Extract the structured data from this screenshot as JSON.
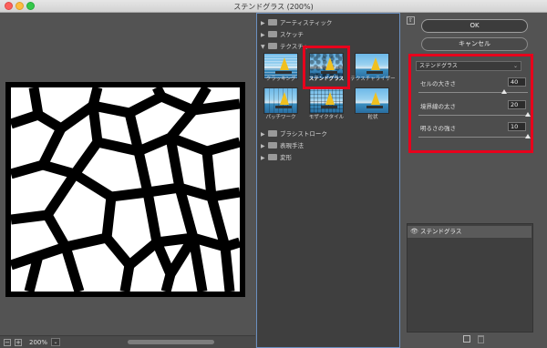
{
  "window": {
    "title": "ステンドグラス (200%)"
  },
  "preview": {
    "zoom_level": "200%",
    "zoom_out_label": "−",
    "zoom_in_label": "+",
    "dropdown_glyph": "⌄"
  },
  "gallery": {
    "categories": [
      {
        "label": "アーティスティック",
        "expanded": false
      },
      {
        "label": "スケッチ",
        "expanded": false
      },
      {
        "label": "テクスチャ",
        "expanded": true
      }
    ],
    "texture_items": [
      {
        "label": "クラッキング",
        "selected": false
      },
      {
        "label": "ステンドグラス",
        "selected": true
      },
      {
        "label": "テクスチャライザー",
        "selected": false
      },
      {
        "label": "パッチワーク",
        "selected": false
      },
      {
        "label": "モザイクタイル",
        "selected": false
      },
      {
        "label": "粒状",
        "selected": false
      }
    ],
    "more_categories": [
      {
        "label": "ブラシストローク"
      },
      {
        "label": "表現手法"
      },
      {
        "label": "変形"
      }
    ],
    "arrow_collapsed": "▶",
    "arrow_expanded": "▼"
  },
  "actions": {
    "ok_label": "OK",
    "cancel_label": "キャンセル",
    "collapse_glyph": "⇧"
  },
  "filter_settings": {
    "selected_filter": "ステンドグラス",
    "chevron": "⌄",
    "params": [
      {
        "label": "セルの大きさ",
        "value": "40",
        "fraction": 0.78
      },
      {
        "label": "境界線の太さ",
        "value": "20",
        "fraction": 1.0
      },
      {
        "label": "明るさの強さ",
        "value": "10",
        "fraction": 1.0
      }
    ]
  },
  "layers": {
    "items": [
      {
        "label": "ステンドグラス",
        "eye_glyph": "👁"
      }
    ]
  },
  "colors": {
    "highlight": "#e8001c",
    "panel": "#535353"
  }
}
